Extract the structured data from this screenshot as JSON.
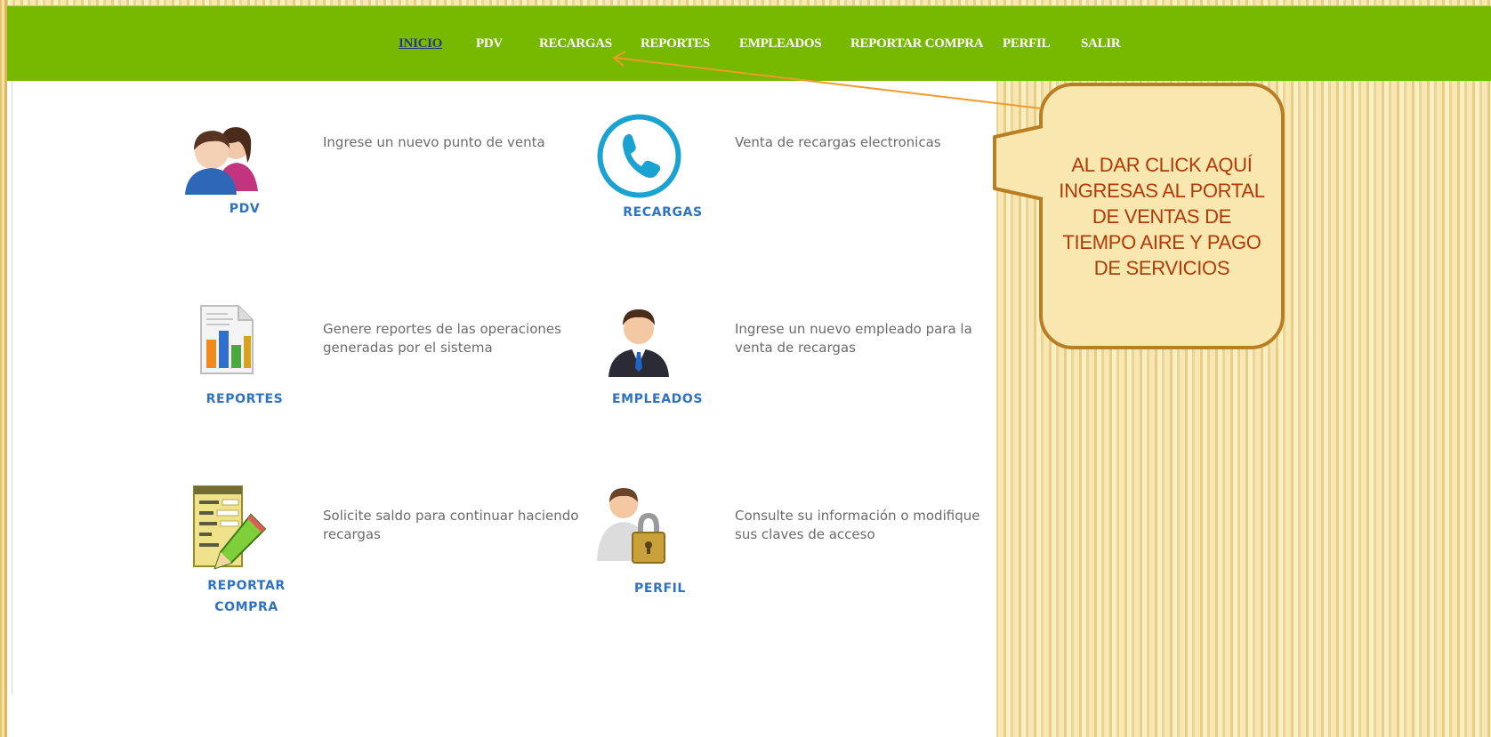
{
  "nav": {
    "inicio": "INICIO",
    "pdv": "PDV",
    "recargas": "RECARGAS",
    "reportes": "REPORTES",
    "empleados": "EMPLEADOS",
    "reportar_compra": "REPORTAR COMPRA",
    "perfil": "PERFIL",
    "salir": "SALIR"
  },
  "tiles": {
    "pdv": {
      "label": "PDV",
      "description": "Ingrese un nuevo punto de venta",
      "icon": "users-icon"
    },
    "recargas": {
      "label": "RECARGAS",
      "description": "Venta de recargas electronicas",
      "icon": "phone-icon"
    },
    "reportes": {
      "label": "REPORTES",
      "description": "Genere reportes de las operaciones generadas por el sistema",
      "icon": "report-chart-icon"
    },
    "empleados": {
      "label": "EMPLEADOS",
      "description": "Ingrese un nuevo empleado para la venta de recargas",
      "icon": "employee-icon"
    },
    "reportar_compra": {
      "label": "REPORTAR\nCOMPRA",
      "description": "Solicite saldo para continuar haciendo recargas",
      "icon": "form-pencil-icon"
    },
    "perfil": {
      "label": "PERFIL",
      "description": "Consulte su información o modifique sus claves de acceso",
      "icon": "user-lock-icon"
    }
  },
  "callout": {
    "text": "AL DAR CLICK AQUÍ INGRESAS AL PORTAL DE VENTAS DE TIEMPO AIRE Y PAGO DE SERVICIOS"
  },
  "colors": {
    "navbar": "#77b900",
    "nav_text": "#ffffff",
    "nav_active": "#2c3a86",
    "tile_label": "#2e73c1",
    "description": "#6b6b6b",
    "callout_border": "#b87e24",
    "callout_text": "#b03a08",
    "arrow": "#f09a2c"
  }
}
